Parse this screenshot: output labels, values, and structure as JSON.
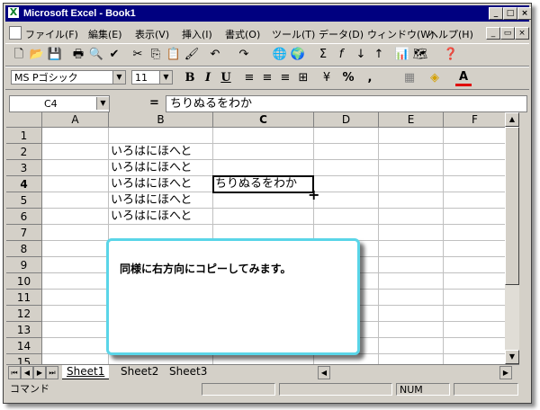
{
  "window": {
    "title": "Microsoft Excel - Book1"
  },
  "menu": [
    "ファイル(F)",
    "編集(E)",
    "表示(V)",
    "挿入(I)",
    "書式(O)",
    "ツール(T)",
    "データ(D)",
    "ウィンドウ(W)",
    "ヘルプ(H)"
  ],
  "formatting": {
    "font": "MS Pゴシック",
    "size": "11",
    "bold": "B",
    "italic": "I",
    "underline": "U",
    "percent": "%",
    "comma": ",",
    "font_color_letter": "A"
  },
  "formula_bar": {
    "name_box": "C4",
    "equals": "=",
    "value": "ちりぬるをわか"
  },
  "columns": [
    "A",
    "B",
    "C",
    "D",
    "E",
    "F"
  ],
  "rows": [
    "1",
    "2",
    "3",
    "4",
    "5",
    "6",
    "7",
    "8",
    "9",
    "10",
    "11",
    "12",
    "13",
    "14",
    "15"
  ],
  "cells": {
    "B2": "いろはにほへと",
    "B3": "いろはにほへと",
    "B4": "いろはにほへと",
    "B5": "いろはにほへと",
    "B6": "いろはにほへと",
    "C4": "ちりぬるをわか"
  },
  "sheets": [
    "Sheet1",
    "Sheet2",
    "Sheet3"
  ],
  "status": {
    "mode": "コマンド",
    "num": "NUM"
  },
  "callout": {
    "text": "同様に右方向にコピーしてみます。"
  },
  "colors": {
    "title_bar": "#000080",
    "callout_border": "#5ad5e8",
    "excel_green": "#0a7d28"
  }
}
